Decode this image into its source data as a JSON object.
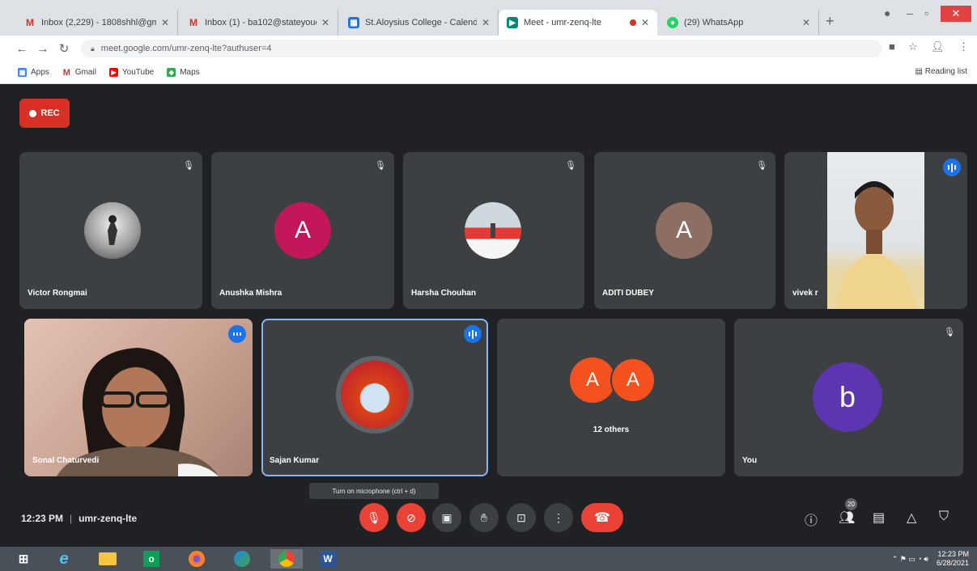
{
  "browser": {
    "tabs": [
      {
        "title": "Inbox (2,229) - 1808shhl@gm",
        "favicon": "gmail-icon",
        "color": "#d93025"
      },
      {
        "title": "Inbox (1) - ba102@stateyouc",
        "favicon": "gmail-icon",
        "color": "#d93025"
      },
      {
        "title": "St.Aloysius College - Calenda",
        "favicon": "calendar-icon",
        "color": "#1a73e8"
      },
      {
        "title": "Meet - umr-zenq-lte",
        "favicon": "meet-icon",
        "color": "#00897b"
      },
      {
        "title": "(29) WhatsApp",
        "favicon": "whatsapp-icon",
        "color": "#25d366"
      }
    ],
    "url": "meet.google.com/umr-zenq-lte?authuser=4",
    "bookmarks": [
      "Apps",
      "Gmail",
      "YouTube",
      "Maps"
    ],
    "reading_list": "Reading list"
  },
  "meet": {
    "rec_label": "REC",
    "participants_row1": [
      {
        "name": "Victor Rongmai",
        "kind": "photo"
      },
      {
        "name": "Anushka Mishra",
        "kind": "letter",
        "letter": "A",
        "color": "#c2185b"
      },
      {
        "name": "Harsha Chouhan",
        "kind": "photo"
      },
      {
        "name": "ADITI DUBEY",
        "kind": "letter",
        "letter": "A",
        "color": "#8d6e63"
      },
      {
        "name": "vivek r",
        "kind": "video"
      }
    ],
    "participants_row2": [
      {
        "name": "Sonal Chaturvedi",
        "kind": "video"
      },
      {
        "name": "Sajan Kumar",
        "kind": "photo"
      },
      {
        "name": "12 others",
        "kind": "group",
        "letters": [
          "A",
          "A"
        ],
        "color": "#f4511e"
      },
      {
        "name": "You",
        "kind": "letter",
        "letter": "b",
        "color": "#5e35b1"
      }
    ],
    "tooltip": "Turn on microphone (ctrl + d)",
    "time": "12:23 PM",
    "meeting_code": "umr-zenq-lte",
    "people_count": "20"
  },
  "taskbar": {
    "time": "12:23 PM",
    "date": "6/28/2021"
  }
}
